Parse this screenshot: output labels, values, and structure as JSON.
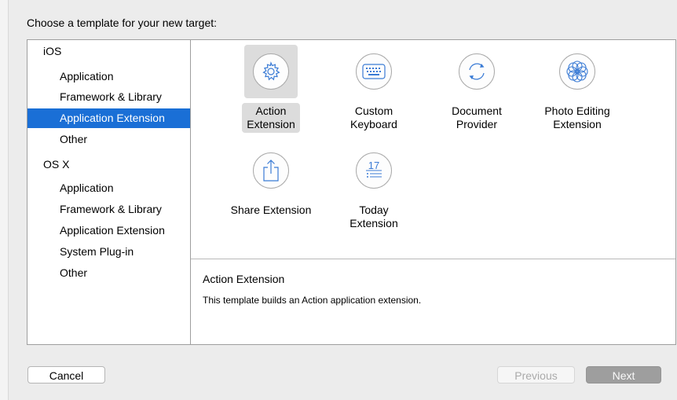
{
  "header": {
    "title": "Choose a template for your new target:"
  },
  "sidebar": {
    "items": [
      {
        "label": "iOS",
        "kind": "group"
      },
      {
        "label": "Application",
        "kind": "sub"
      },
      {
        "label": "Framework & Library",
        "kind": "sub"
      },
      {
        "label": "Application Extension",
        "kind": "sub",
        "selected": true
      },
      {
        "label": "Other",
        "kind": "sub"
      },
      {
        "label": "OS X",
        "kind": "group"
      },
      {
        "label": "Application",
        "kind": "sub"
      },
      {
        "label": "Framework & Library",
        "kind": "sub"
      },
      {
        "label": "Application Extension",
        "kind": "sub"
      },
      {
        "label": "System Plug-in",
        "kind": "sub"
      },
      {
        "label": "Other",
        "kind": "sub"
      }
    ]
  },
  "templates": [
    {
      "line1": "Action",
      "line2": "Extension",
      "icon": "gear-icon",
      "selected": true
    },
    {
      "line1": "Custom",
      "line2": "Keyboard",
      "icon": "keyboard-icon"
    },
    {
      "line1": "Document",
      "line2": "Provider",
      "icon": "refresh-icon"
    },
    {
      "line1": "Photo Editing",
      "line2": "Extension",
      "icon": "flower-icon"
    },
    {
      "line1": "Share Extension",
      "line2": "",
      "icon": "share-icon"
    },
    {
      "line1": "Today",
      "line2": "Extension",
      "icon": "calendar-list-icon",
      "calendar_day": "17"
    }
  ],
  "description": {
    "title": "Action Extension",
    "body": "This template builds an Action application extension."
  },
  "buttons": {
    "cancel": "Cancel",
    "previous": "Previous",
    "next": "Next"
  }
}
